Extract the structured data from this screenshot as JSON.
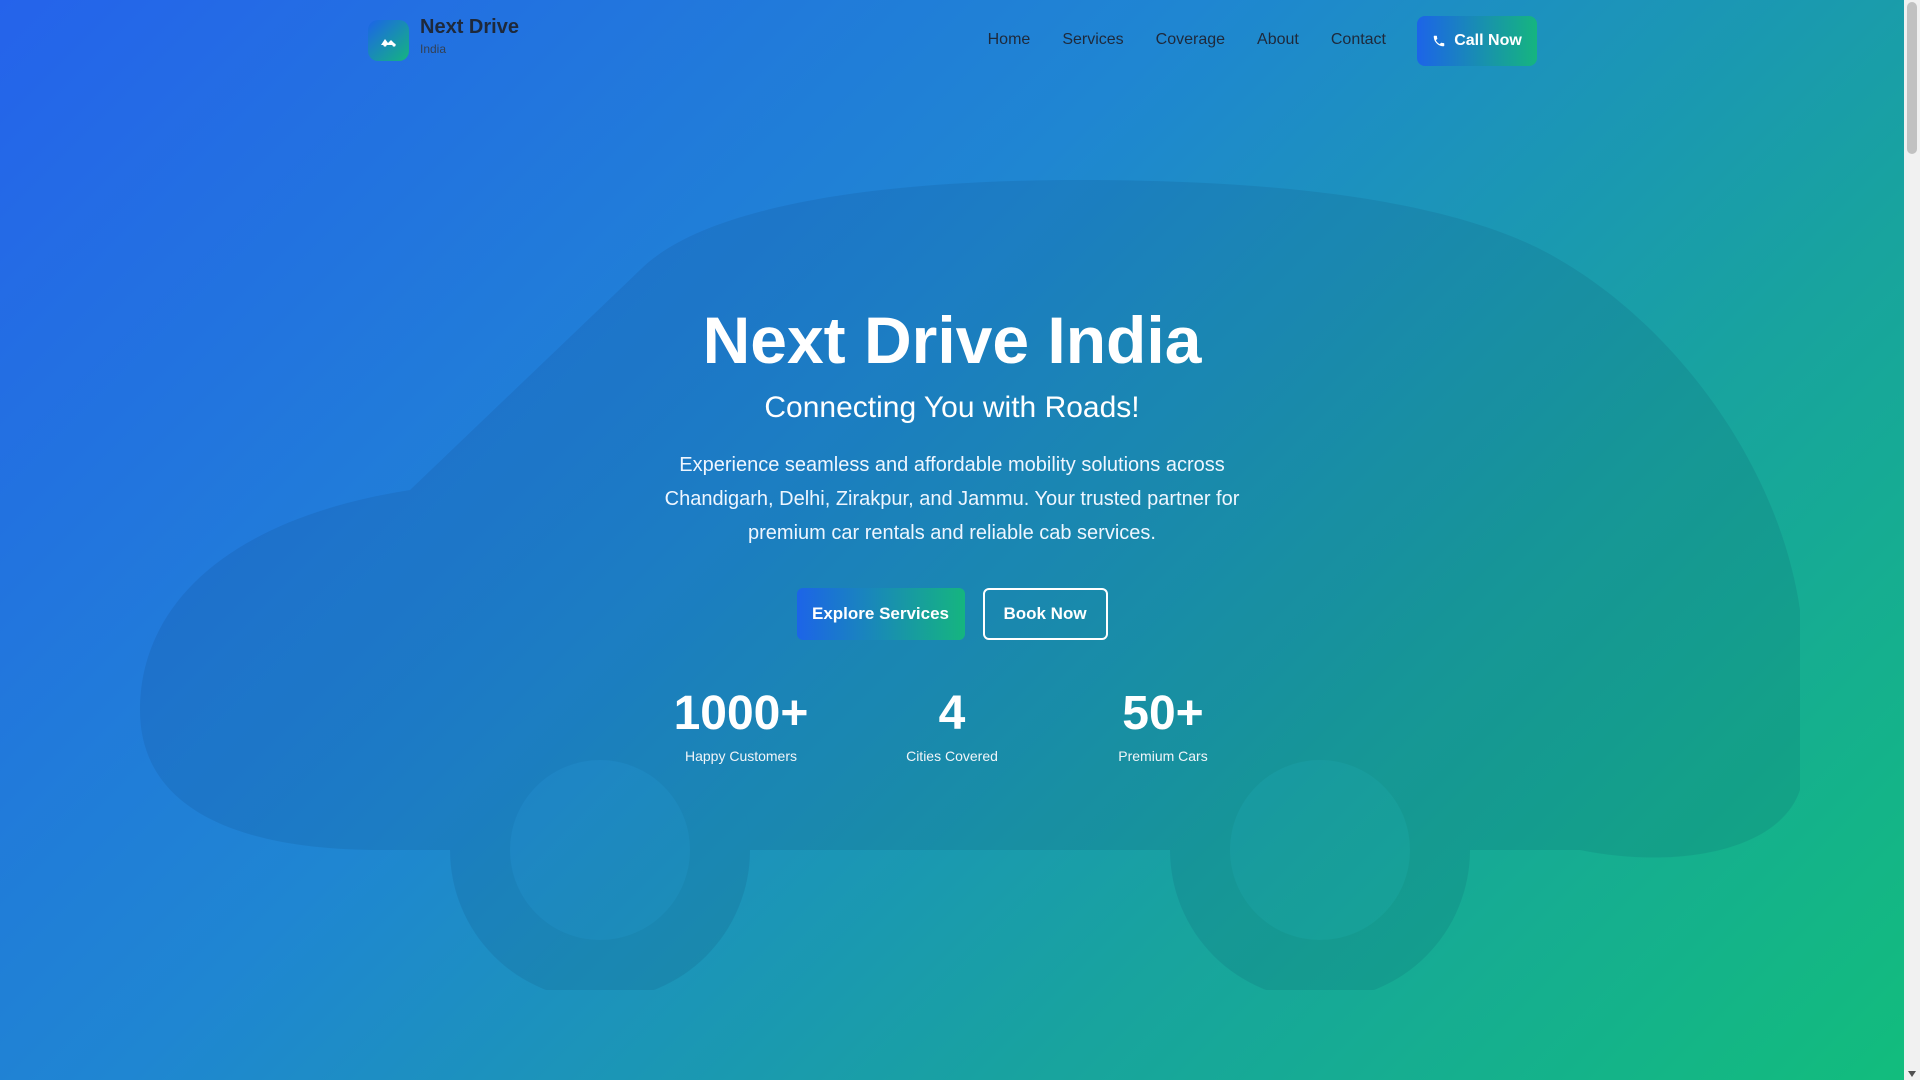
{
  "brand": {
    "name": "Next Drive",
    "sub": "India"
  },
  "nav": {
    "items": [
      "Home",
      "Services",
      "Coverage",
      "About",
      "Contact"
    ],
    "call_label": "Call Now"
  },
  "hero": {
    "title": "Next Drive India",
    "subtitle": "Connecting You with Roads!",
    "description": "Experience seamless and affordable mobility solutions across Chandigarh, Delhi, Zirakpur, and Jammu. Your trusted partner for premium car rentals and reliable cab services.",
    "primary_button": "Explore Services",
    "secondary_button": "Book Now"
  },
  "stats": [
    {
      "value": "1000+",
      "label": "Happy Customers"
    },
    {
      "value": "4",
      "label": "Cities Covered"
    },
    {
      "value": "50+",
      "label": "Premium Cars"
    }
  ],
  "icons": {
    "logo": "car-icon",
    "call": "phone-icon"
  },
  "colors": {
    "gradient_start": "#2563eb",
    "gradient_end": "#12bd7c",
    "text_dark": "#1e293b"
  }
}
